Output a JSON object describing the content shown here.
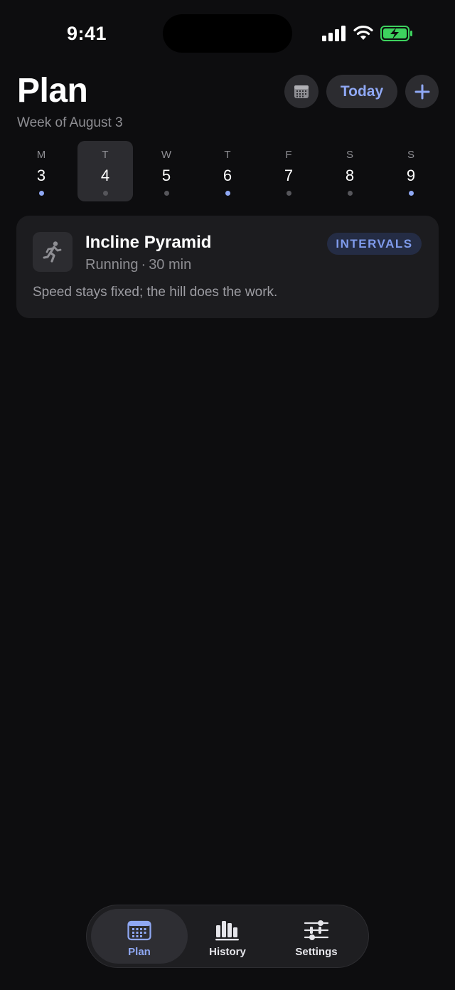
{
  "status_bar": {
    "time": "9:41",
    "battery_color": "#3dd25e",
    "signal_bars": 4
  },
  "header": {
    "title": "Plan",
    "subtitle": "Week of August 3",
    "calendar_icon": "calendar-grid-icon",
    "today_label": "Today",
    "add_icon": "plus-icon",
    "accent_color": "#8fa8f4"
  },
  "week": {
    "days": [
      {
        "letter": "M",
        "num": "3",
        "dot": "accent"
      },
      {
        "letter": "T",
        "num": "4",
        "dot": "muted",
        "selected": true
      },
      {
        "letter": "W",
        "num": "5",
        "dot": "muted"
      },
      {
        "letter": "T",
        "num": "6",
        "dot": "accent"
      },
      {
        "letter": "F",
        "num": "7",
        "dot": "muted"
      },
      {
        "letter": "S",
        "num": "8",
        "dot": "muted"
      },
      {
        "letter": "S",
        "num": "9",
        "dot": "accent"
      }
    ],
    "dot_colors": {
      "accent": "#8fa8f4",
      "muted": "#56565b"
    }
  },
  "workout": {
    "icon": "running-figure-icon",
    "title": "Incline Pyramid",
    "sport": "Running",
    "separator": "·",
    "duration": "30 min",
    "badge": "INTERVALS",
    "description": "Speed stays fixed; the hill does the work."
  },
  "tabbar": {
    "tabs": [
      {
        "label": "Plan",
        "icon": "calendar-icon",
        "active": true
      },
      {
        "label": "History",
        "icon": "bar-chart-icon",
        "active": false
      },
      {
        "label": "Settings",
        "icon": "sliders-icon",
        "active": false
      }
    ]
  }
}
